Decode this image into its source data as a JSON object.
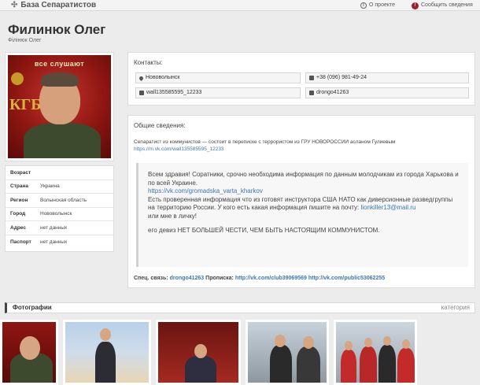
{
  "topbar": {
    "brand": "База Сепаратистов",
    "about": "О проекте",
    "report": "Сообщить сведения"
  },
  "profile": {
    "name": "Филинюк Олег",
    "subname": "Філінюк Олег",
    "photo_caption": "все слушают",
    "photo_text": "КГБ"
  },
  "info": [
    {
      "key": "Возраст",
      "value": ""
    },
    {
      "key": "Страна",
      "value": "Украина"
    },
    {
      "key": "Регион",
      "value": "Волынская область"
    },
    {
      "key": "Город",
      "value": "Нововолынск"
    },
    {
      "key": "Адрес",
      "value": "нет данных"
    },
    {
      "key": "Паспорт",
      "value": "нет данных"
    }
  ],
  "contacts": {
    "title": "Контакты:",
    "city": "Нововолынск",
    "phone": "+38 (096) 981-49-24",
    "vk": "wall135585595_12233",
    "skype": "drongo41263"
  },
  "general": {
    "title": "Общие сведения:",
    "desc": "Сепаратист из коммунистов — состоит в переписке с террористом из ГРУ НОВОРОССИИ асланом Гулиевым",
    "desc_link": "https://m.vk.com/wall135585595_12233",
    "quote_1": "Всем здравия! Соратники, срочно необходима информация по данным молодчикам из города Харькова и по всей Украине.",
    "quote_link_1": "https://vk.com/gromadska_varta_kharkov",
    "quote_2": "Есть проверенная информация что из готовят инструктора США НАТО как диверсионные разведгруппы на территорию России. У кого есть какая информация пишите на почту:",
    "quote_email": "lionkiller13@mail.ru",
    "quote_3": "или мне в личку!",
    "quote_4": "его девиз НЕТ БОЛЬШЕЙ ЧЕСТИ, ЧЕМ БЫТЬ НАСТОЯЩИМ КОММУНИСТОМ.",
    "special_label": "Спец. связь:",
    "special_value": "drongo41263",
    "registration_label": "Прописка:",
    "registration_1": "http://vk.com/club39069569",
    "registration_2": "http://vk.com/public53062255"
  },
  "photos": {
    "title": "Фотографии",
    "category": "категория"
  }
}
